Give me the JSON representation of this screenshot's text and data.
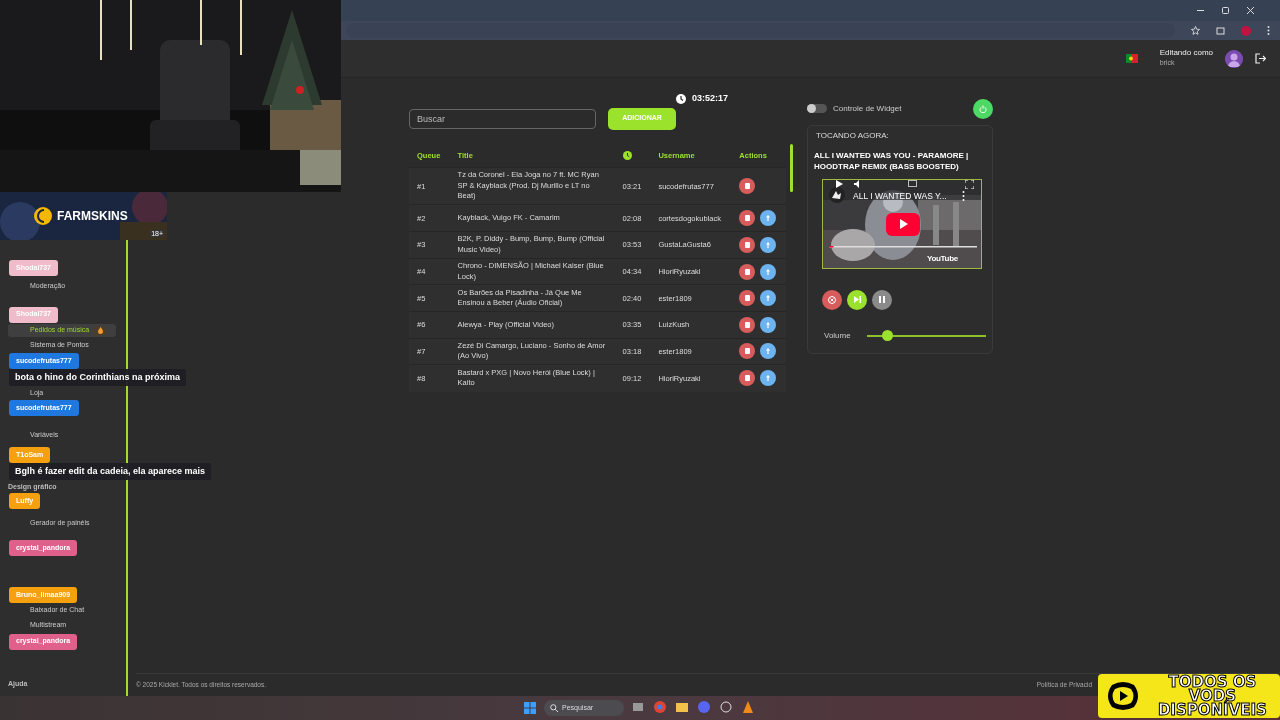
{
  "header": {
    "editing_label": "Editando como",
    "username": "brick"
  },
  "promo": {
    "brand": "FARMSKINS",
    "age": "18+"
  },
  "sidebar": {
    "items": [
      {
        "label": "Moderação",
        "kind": "item",
        "selected": false,
        "hot": false
      },
      {
        "label": "Pedidos de música",
        "kind": "item",
        "selected": true,
        "hot": true
      },
      {
        "label": "Sistema de Pontos",
        "kind": "item",
        "selected": false,
        "hot": false
      },
      {
        "label": "Loja",
        "kind": "item",
        "selected": false,
        "hot": false
      },
      {
        "label": "Variáveis",
        "kind": "item",
        "selected": false,
        "hot": false
      },
      {
        "label": "Design gráfico",
        "kind": "heading"
      },
      {
        "label": "Gerador de painéis",
        "kind": "item",
        "selected": false,
        "hot": false
      },
      {
        "label": "Baixador de Chat",
        "kind": "item",
        "selected": false,
        "hot": false
      },
      {
        "label": "Multistream",
        "kind": "item",
        "selected": false,
        "hot": false
      },
      {
        "label": "Ajuda",
        "kind": "heading"
      }
    ]
  },
  "chat_overlay": {
    "messages": [
      {
        "user": "Shodai737",
        "color": "#f0bccb"
      },
      {
        "user": "Shodai737",
        "color": "#f0bccb"
      },
      {
        "user": "sucodefrutas777",
        "color": "#1e78e0",
        "text": "bota o hino do Corinthians na próxima"
      },
      {
        "user": "sucodefrutas777",
        "color": "#1e78e0"
      },
      {
        "user": "T1oSam",
        "color": "#f5a00f",
        "text": "Bglh é fazer edit da cadeia, ela aparece mais"
      },
      {
        "user": "Luffy",
        "color": "#f5a00f"
      },
      {
        "user": "crystal_pandora",
        "color": "#e0608c"
      },
      {
        "user": "Bruno_limaa909",
        "color": "#f5a00f"
      },
      {
        "user": "crystal_pandora",
        "color": "#e0608c"
      }
    ]
  },
  "clock": "03:52:17",
  "search": {
    "placeholder": "Buscar"
  },
  "add_button": "ADICIONAR",
  "queue": {
    "columns": [
      {
        "kind": "text",
        "label": "Queue"
      },
      {
        "kind": "text",
        "label": "Title"
      },
      {
        "kind": "icon"
      },
      {
        "kind": "text",
        "label": "Username"
      },
      {
        "kind": "text",
        "label": "Actions"
      }
    ],
    "rows": [
      {
        "position": "#1",
        "title": "Tz da Coronel - Ela Joga no 7 ft. MC Ryan SP & Kayblack (Prod. Dj Murillo e LT no Beat)",
        "duration": "03:21",
        "username": "sucodefrutas777",
        "movable": false
      },
      {
        "position": "#2",
        "title": "Kayblack, Vulgo FK - Camarim",
        "duration": "02:08",
        "username": "cortesdogokublack",
        "movable": true
      },
      {
        "position": "#3",
        "title": "B2K, P. Diddy - Bump, Bump, Bump (Official Music Video)",
        "duration": "03:53",
        "username": "GustaLaGusta6",
        "movable": true
      },
      {
        "position": "#4",
        "title": "Chrono - DIMENSÃO | Michael Kaiser (Blue Lock)",
        "duration": "04:34",
        "username": "HioriRyuzaki",
        "movable": true
      },
      {
        "position": "#5",
        "title": "Os Barões da Pisadinha - Já Que Me Ensinou a Beber (Áudio Oficial)",
        "duration": "02:40",
        "username": "ester1809",
        "movable": true
      },
      {
        "position": "#6",
        "title": "Alewya - Play (Official Video)",
        "duration": "03:35",
        "username": "LuizKush",
        "movable": true
      },
      {
        "position": "#7",
        "title": "Zezé Di Camargo, Luciano - Sonho de Amor (Ao Vivo)",
        "duration": "03:18",
        "username": "ester1809",
        "movable": true
      },
      {
        "position": "#8",
        "title": "Bastard x PXG | Novo Herói (Blue Lock) | Kaito",
        "duration": "09:12",
        "username": "HioriRyuzaki",
        "movable": true
      }
    ]
  },
  "widget": {
    "label": "Controle de Widget",
    "on": false
  },
  "now_playing": {
    "heading": "TOCANDO AGORA:",
    "title": "ALL I WANTED WAS YOU - PARAMORE | HOODTRAP REMIX (BASS BOOSTED)",
    "video_title": "ALL I WANTED WAS Y...",
    "video_brand": "YouTube",
    "video_progress": {
      "level": 0.03
    }
  },
  "volume": {
    "label": "Volume",
    "level": 0.17
  },
  "footer": {
    "copyright": "© 2025 Kicklet. Todos os direitos reservados.",
    "privacy": "Política de Privacid"
  },
  "vod_badge": [
    "TODOS OS VODS",
    "DISPONÍVEIS"
  ],
  "taskbar": {
    "search_placeholder": "Pesquisar"
  }
}
